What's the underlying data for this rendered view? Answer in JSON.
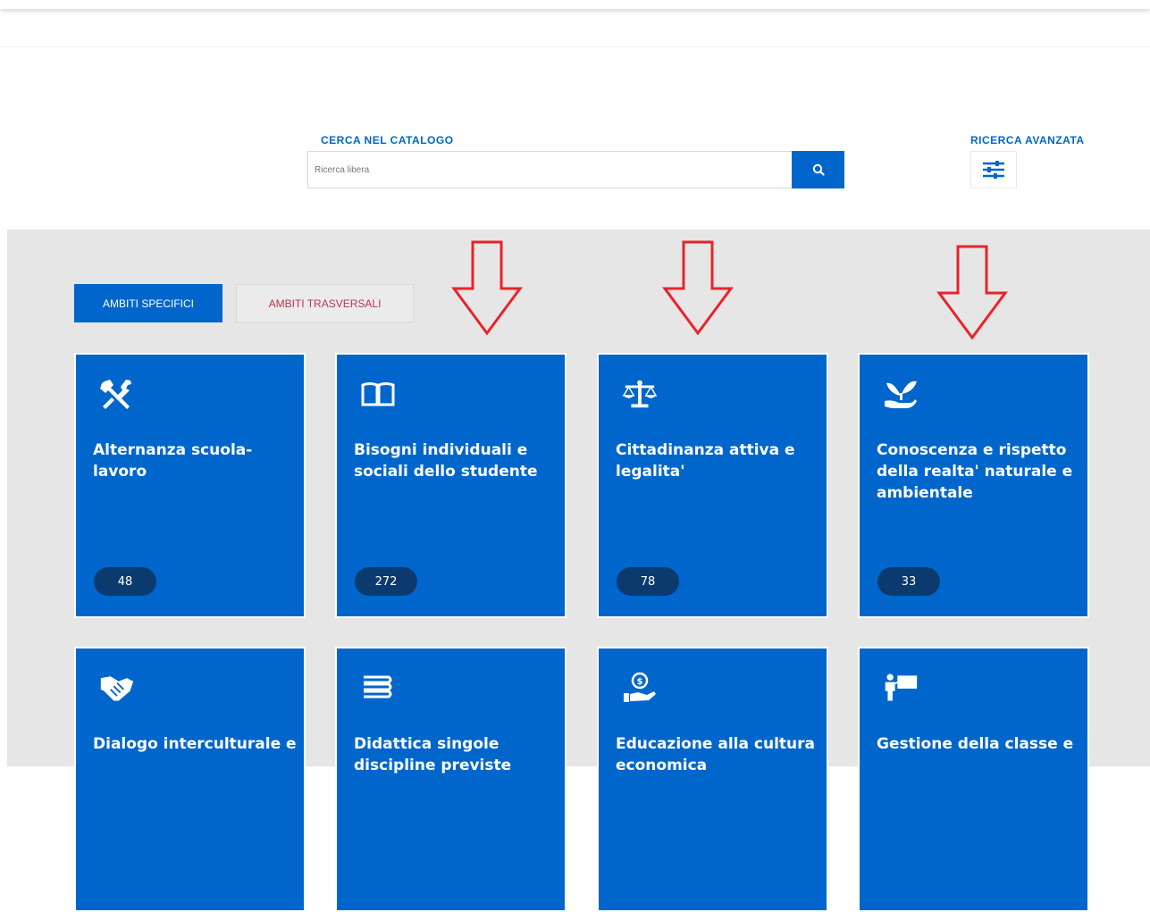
{
  "search": {
    "label": "CERCA NEL CATALOGO",
    "placeholder": "Ricerca libera",
    "advanced_label": "RICERCA AVANZATA"
  },
  "tabs": [
    {
      "label": "AMBITI SPECIFICI",
      "active": true
    },
    {
      "label": "AMBITI TRASVERSALI",
      "active": false
    }
  ],
  "cards": [
    {
      "title": "Alternanza scuola-lavoro",
      "count": "48",
      "icon": "tools-icon"
    },
    {
      "title": "Bisogni individuali e sociali dello studente",
      "count": "272",
      "icon": "open-book-icon"
    },
    {
      "title": "Cittadinanza attiva e legalita'",
      "count": "78",
      "icon": "balance-scale-icon"
    },
    {
      "title": "Conoscenza e rispetto della realta' naturale e ambientale",
      "count": "33",
      "icon": "hand-plant-icon"
    },
    {
      "title": "Dialogo interculturale e",
      "icon": "handshake-icon"
    },
    {
      "title": "Didattica singole discipline previste",
      "icon": "books-stack-icon"
    },
    {
      "title": "Educazione alla cultura economica",
      "icon": "hand-coin-icon"
    },
    {
      "title": "Gestione della classe e",
      "icon": "teacher-board-icon"
    }
  ],
  "colors": {
    "accent": "#0066cc",
    "badge": "#0b3b6e",
    "arrow": "#e8242a",
    "secondary_tab_text": "#b7364f",
    "catalog_bg": "#e6e6e6"
  }
}
